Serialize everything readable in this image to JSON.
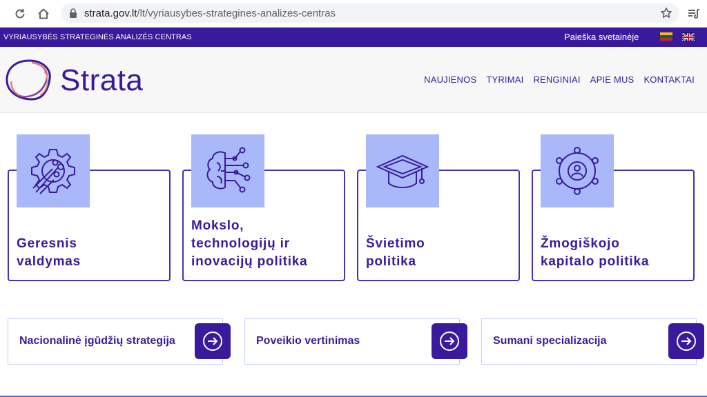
{
  "browser": {
    "url_host": "strata.gov.lt",
    "url_path": "/lt/vyriausybes-strategines-analizes-centras"
  },
  "topbar": {
    "org_name": "VYRIAUSYBĖS STRATEGINĖS ANALIZĖS CENTRAS",
    "search_label": "Paieška svetainėje",
    "languages": [
      "lt-flag",
      "en-flag"
    ]
  },
  "header": {
    "logo_text": "Strata",
    "nav": [
      "NAUJIENOS",
      "TYRIMAI",
      "RENGINIAI",
      "APIE MUS",
      "KONTAKTAI"
    ]
  },
  "cards": [
    {
      "title": "Geresnis\nvaldymas",
      "icon": "gear-icon"
    },
    {
      "title": "Mokslo,\ntechnologijų ir\ninovacijų politika",
      "icon": "brain-circuit-icon"
    },
    {
      "title": "Švietimo\npolitika",
      "icon": "graduation-cap-icon"
    },
    {
      "title": "Žmogiškojo\nkapitalo politika",
      "icon": "people-network-icon"
    }
  ],
  "links": [
    {
      "label": "Nacionalinė įgūdžių strategija"
    },
    {
      "label": "Poveikio vertinimas"
    },
    {
      "label": "Sumani specializacija"
    }
  ],
  "colors": {
    "brand": "#3a1a9c",
    "icon_bg": "#a8b8f8",
    "link_border": "#c5cff5"
  }
}
